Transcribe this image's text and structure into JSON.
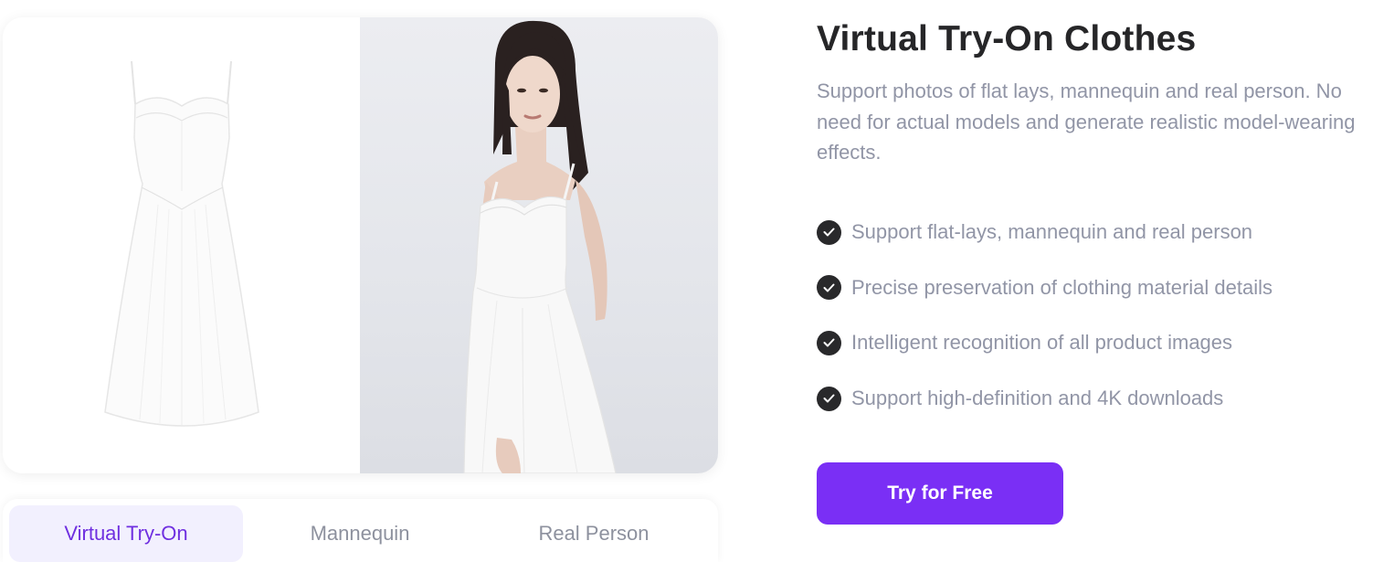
{
  "showcase": {
    "left_image": "white-dress-flat-lay",
    "right_image": "model-wearing-white-dress"
  },
  "tabs": [
    {
      "label": "Virtual Try-On",
      "active": true
    },
    {
      "label": "Mannequin",
      "active": false
    },
    {
      "label": "Real Person",
      "active": false
    }
  ],
  "content": {
    "title": "Virtual Try-On Clothes",
    "description": "Support photos of flat lays, mannequin and real person. No need for actual models and generate realistic model-wearing effects.",
    "features": [
      "Support flat-lays, mannequin and real person",
      "Precise preservation of clothing material details",
      "Intelligent recognition of all product images",
      "Support high-definition and 4K downloads"
    ],
    "feature_icon": "check-circle-icon",
    "cta_label": "Try for Free"
  },
  "colors": {
    "accent": "#7a2ff5",
    "active_tab_text": "#6f2fe0",
    "active_tab_bg": "#f2f0fe",
    "title": "#262628",
    "muted_text": "#9195a6",
    "check_bg": "#29292b"
  }
}
